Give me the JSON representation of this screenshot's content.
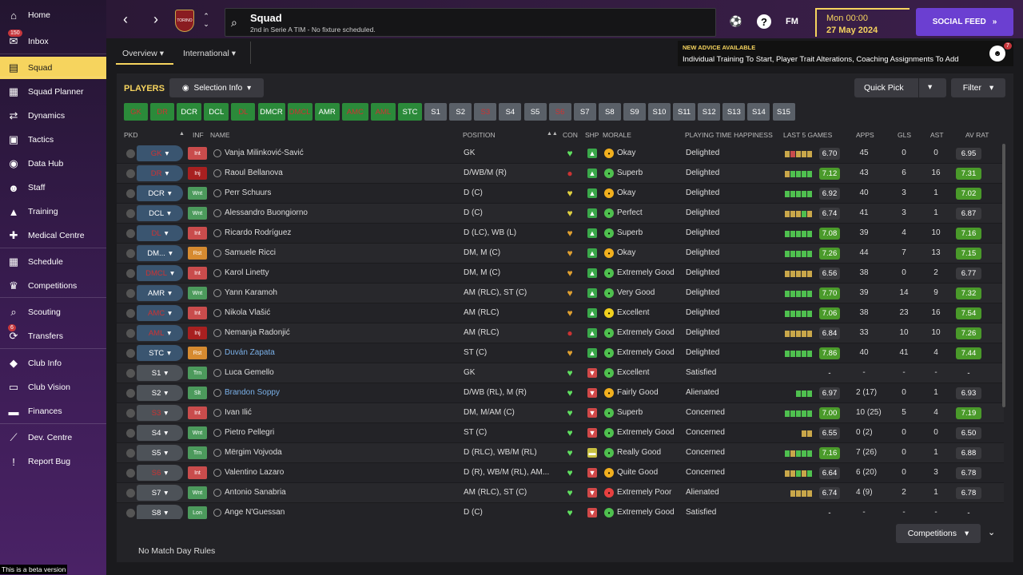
{
  "sidebar": {
    "items": [
      {
        "label": "Home",
        "icon": "home-icon",
        "glyph": "⌂",
        "badge": ""
      },
      {
        "label": "Inbox",
        "icon": "inbox-icon",
        "glyph": "✉",
        "badge": "150"
      },
      {
        "label": "Squad",
        "icon": "squad-icon",
        "glyph": "▤",
        "badge": "",
        "active": true
      },
      {
        "label": "Squad Planner",
        "icon": "squad-planner-icon",
        "glyph": "▦",
        "badge": ""
      },
      {
        "label": "Dynamics",
        "icon": "dynamics-icon",
        "glyph": "⇄",
        "badge": ""
      },
      {
        "label": "Tactics",
        "icon": "tactics-icon",
        "glyph": "▣",
        "badge": ""
      },
      {
        "label": "Data Hub",
        "icon": "data-hub-icon",
        "glyph": "◉",
        "badge": ""
      },
      {
        "label": "Staff",
        "icon": "staff-icon",
        "glyph": "☻",
        "badge": ""
      },
      {
        "label": "Training",
        "icon": "training-icon",
        "glyph": "▲",
        "badge": ""
      },
      {
        "label": "Medical Centre",
        "icon": "medical-icon",
        "glyph": "✚",
        "badge": ""
      },
      {
        "label": "Schedule",
        "icon": "schedule-icon",
        "glyph": "▦",
        "badge": ""
      },
      {
        "label": "Competitions",
        "icon": "trophy-icon",
        "glyph": "♛",
        "badge": ""
      },
      {
        "label": "Scouting",
        "icon": "scouting-icon",
        "glyph": "⌕",
        "badge": ""
      },
      {
        "label": "Transfers",
        "icon": "transfers-icon",
        "glyph": "⟳",
        "badge": "6"
      },
      {
        "label": "Club Info",
        "icon": "club-info-icon",
        "glyph": "◆",
        "badge": ""
      },
      {
        "label": "Club Vision",
        "icon": "club-vision-icon",
        "glyph": "▭",
        "badge": ""
      },
      {
        "label": "Finances",
        "icon": "finances-icon",
        "glyph": "▬",
        "badge": ""
      },
      {
        "label": "Dev. Centre",
        "icon": "dev-centre-icon",
        "glyph": "⟋",
        "badge": ""
      },
      {
        "label": "Report Bug",
        "icon": "report-bug-icon",
        "glyph": "!",
        "badge": ""
      }
    ],
    "beta_note": "This is a beta version"
  },
  "header": {
    "title": "Squad",
    "subtitle": "2nd in Serie A TIM - No fixture scheduled.",
    "crest_text": "TORINO",
    "fm_logo": "FM",
    "date_time": "Mon 00:00",
    "date_day": "27 May 2024",
    "social_feed": "SOCIAL FEED"
  },
  "subtabs": {
    "overview": "Overview",
    "international": "International"
  },
  "advice": {
    "title": "NEW ADVICE AVAILABLE",
    "body": "Individual Training To Start, Player Trait Alterations, Coaching Assignments To Add",
    "badge": "7"
  },
  "panel": {
    "players_label": "PLAYERS",
    "selection_info": "Selection Info",
    "quick_pick": "Quick Pick",
    "filter": "Filter",
    "no_rules": "No Match Day Rules",
    "competitions": "Competitions"
  },
  "position_chips": [
    {
      "label": "GK",
      "kind": "inj"
    },
    {
      "label": "DR",
      "kind": "inj"
    },
    {
      "label": "DCR",
      "kind": "pos"
    },
    {
      "label": "DCL",
      "kind": "pos"
    },
    {
      "label": "DL",
      "kind": "inj"
    },
    {
      "label": "DMCR",
      "kind": "pos"
    },
    {
      "label": "DMCL",
      "kind": "inj"
    },
    {
      "label": "AMR",
      "kind": "pos"
    },
    {
      "label": "AMC",
      "kind": "inj"
    },
    {
      "label": "AML",
      "kind": "inj"
    },
    {
      "label": "STC",
      "kind": "pos"
    },
    {
      "label": "S1",
      "kind": "sub"
    },
    {
      "label": "S2",
      "kind": "sub"
    },
    {
      "label": "S3",
      "kind": "subinj"
    },
    {
      "label": "S4",
      "kind": "sub"
    },
    {
      "label": "S5",
      "kind": "sub"
    },
    {
      "label": "S6",
      "kind": "subinj"
    },
    {
      "label": "S7",
      "kind": "sub"
    },
    {
      "label": "S8",
      "kind": "sub"
    },
    {
      "label": "S9",
      "kind": "sub"
    },
    {
      "label": "S10",
      "kind": "sub"
    },
    {
      "label": "S11",
      "kind": "sub"
    },
    {
      "label": "S12",
      "kind": "sub"
    },
    {
      "label": "S13",
      "kind": "sub"
    },
    {
      "label": "S14",
      "kind": "sub"
    },
    {
      "label": "S15",
      "kind": "sub"
    }
  ],
  "columns": {
    "pkd": "PKD",
    "inf": "INF",
    "name": "NAME",
    "position": "POSITION",
    "con": "CON",
    "shp": "SHP",
    "morale": "MORALE",
    "pth": "PLAYING TIME HAPPINESS",
    "last5": "LAST 5 GAMES",
    "apps": "APPS",
    "gls": "GLS",
    "ast": "AST",
    "avrat": "AV RAT"
  },
  "players": [
    {
      "pkd": "GK",
      "pkdinj": true,
      "sub": false,
      "inf": "Int",
      "infc": "#c94c4c",
      "name": "Vanja Milinković-Savić",
      "link": false,
      "position": "GK",
      "con": "green",
      "shp": "green",
      "morale": "Okay",
      "morc": "#f2b01e",
      "pth": "Delighted",
      "l5": [
        "#c9a74a",
        "#c94c4c",
        "#c9a74a",
        "#c9a74a",
        "#c9a74a"
      ],
      "l5rat": "6.70",
      "l5c": "",
      "apps": "45",
      "gls": "0",
      "ast": "0",
      "avrat": "6.95",
      "avc": ""
    },
    {
      "pkd": "DR",
      "pkdinj": true,
      "sub": false,
      "inf": "Inj",
      "infc": "#a82020",
      "name": "Raoul Bellanova",
      "link": false,
      "position": "D/WB/M (R)",
      "con": "red",
      "shp": "green",
      "morale": "Superb",
      "morc": "#4fc04f",
      "pth": "Delighted",
      "l5": [
        "#c9a74a",
        "#4fc04f",
        "#4fc04f",
        "#4fc04f",
        "#4fc04f"
      ],
      "l5rat": "7.12",
      "l5c": "#4a9a2a",
      "apps": "43",
      "gls": "6",
      "ast": "16",
      "avrat": "7.31",
      "avc": "#4a9a2a"
    },
    {
      "pkd": "DCR",
      "pkdinj": false,
      "sub": false,
      "inf": "Wnt",
      "infc": "#4c9a5c",
      "name": "Perr Schuurs",
      "link": false,
      "position": "D (C)",
      "con": "yellow",
      "shp": "green",
      "morale": "Okay",
      "morc": "#f2b01e",
      "pth": "Delighted",
      "l5": [
        "#4fc04f",
        "#4fc04f",
        "#4fc04f",
        "#4fc04f",
        "#4fc04f"
      ],
      "l5rat": "6.92",
      "l5c": "",
      "apps": "40",
      "gls": "3",
      "ast": "1",
      "avrat": "7.02",
      "avc": "#4a9a2a"
    },
    {
      "pkd": "DCL",
      "pkdinj": false,
      "sub": false,
      "inf": "Wnt",
      "infc": "#4c9a5c",
      "name": "Alessandro Buongiorno",
      "link": false,
      "position": "D (C)",
      "con": "yellow",
      "shp": "green",
      "morale": "Perfect",
      "morc": "#4fc04f",
      "pth": "Delighted",
      "l5": [
        "#c9a74a",
        "#c9a74a",
        "#c9a74a",
        "#4fc04f",
        "#c9a74a"
      ],
      "l5rat": "6.74",
      "l5c": "",
      "apps": "41",
      "gls": "3",
      "ast": "1",
      "avrat": "6.87",
      "avc": ""
    },
    {
      "pkd": "DL",
      "pkdinj": true,
      "sub": false,
      "inf": "Int",
      "infc": "#c94c4c",
      "name": "Ricardo Rodríguez",
      "link": false,
      "position": "D (LC), WB (L)",
      "con": "orange",
      "shp": "green",
      "morale": "Superb",
      "morc": "#4fc04f",
      "pth": "Delighted",
      "l5": [
        "#4fc04f",
        "#4fc04f",
        "#4fc04f",
        "#4fc04f",
        "#4fc04f"
      ],
      "l5rat": "7.08",
      "l5c": "#4a9a2a",
      "apps": "39",
      "gls": "4",
      "ast": "10",
      "avrat": "7.16",
      "avc": "#4a9a2a"
    },
    {
      "pkd": "DM...",
      "pkdinj": false,
      "sub": false,
      "inf": "Rst",
      "infc": "#d68a30",
      "name": "Samuele Ricci",
      "link": false,
      "position": "DM, M (C)",
      "con": "orange",
      "shp": "green",
      "morale": "Okay",
      "morc": "#f2b01e",
      "pth": "Delighted",
      "l5": [
        "#4fc04f",
        "#4fc04f",
        "#4fc04f",
        "#4fc04f",
        "#4fc04f"
      ],
      "l5rat": "7.26",
      "l5c": "#4a9a2a",
      "apps": "44",
      "gls": "7",
      "ast": "13",
      "avrat": "7.15",
      "avc": "#4a9a2a"
    },
    {
      "pkd": "DMCL",
      "pkdinj": true,
      "sub": false,
      "inf": "Int",
      "infc": "#c94c4c",
      "name": "Karol Linetty",
      "link": false,
      "position": "DM, M (C)",
      "con": "orange",
      "shp": "green",
      "morale": "Extremely Good",
      "morc": "#4fc04f",
      "pth": "Delighted",
      "l5": [
        "#c9a74a",
        "#c9a74a",
        "#c9a74a",
        "#c9a74a",
        "#c9a74a"
      ],
      "l5rat": "6.56",
      "l5c": "",
      "apps": "38",
      "gls": "0",
      "ast": "2",
      "avrat": "6.77",
      "avc": ""
    },
    {
      "pkd": "AMR",
      "pkdinj": false,
      "sub": false,
      "inf": "Wnt",
      "infc": "#4c9a5c",
      "name": "Yann Karamoh",
      "link": false,
      "position": "AM (RLC), ST (C)",
      "con": "orange",
      "shp": "green",
      "morale": "Very Good",
      "morc": "#4fc04f",
      "pth": "Delighted",
      "l5": [
        "#4fc04f",
        "#4fc04f",
        "#4fc04f",
        "#4fc04f",
        "#4fc04f"
      ],
      "l5rat": "7.70",
      "l5c": "#4a9a2a",
      "apps": "39",
      "gls": "14",
      "ast": "9",
      "avrat": "7.32",
      "avc": "#4a9a2a"
    },
    {
      "pkd": "AMC",
      "pkdinj": true,
      "sub": false,
      "inf": "Int",
      "infc": "#c94c4c",
      "name": "Nikola Vlašić",
      "link": false,
      "position": "AM (RLC)",
      "con": "orange",
      "shp": "green",
      "morale": "Excellent",
      "morc": "#f2d01e",
      "pth": "Delighted",
      "l5": [
        "#4fc04f",
        "#4fc04f",
        "#4fc04f",
        "#4fc04f",
        "#4fc04f"
      ],
      "l5rat": "7.06",
      "l5c": "#4a9a2a",
      "apps": "38",
      "gls": "23",
      "ast": "16",
      "avrat": "7.54",
      "avc": "#4a9a2a"
    },
    {
      "pkd": "AML",
      "pkdinj": true,
      "sub": false,
      "inf": "Inj",
      "infc": "#a82020",
      "name": "Nemanja Radonjić",
      "link": false,
      "position": "AM (RLC)",
      "con": "red",
      "shp": "green",
      "morale": "Extremely Good",
      "morc": "#4fc04f",
      "pth": "Delighted",
      "l5": [
        "#c9a74a",
        "#c9a74a",
        "#c9a74a",
        "#c9a74a",
        "#c9a74a"
      ],
      "l5rat": "6.84",
      "l5c": "",
      "apps": "33",
      "gls": "10",
      "ast": "10",
      "avrat": "7.26",
      "avc": "#4a9a2a"
    },
    {
      "pkd": "STC",
      "pkdinj": false,
      "sub": false,
      "inf": "Rst",
      "infc": "#d68a30",
      "name": "Duván Zapata",
      "link": true,
      "position": "ST (C)",
      "con": "orange",
      "shp": "green",
      "morale": "Extremely Good",
      "morc": "#4fc04f",
      "pth": "Delighted",
      "l5": [
        "#4fc04f",
        "#4fc04f",
        "#4fc04f",
        "#4fc04f",
        "#4fc04f"
      ],
      "l5rat": "7.86",
      "l5c": "#4a9a2a",
      "apps": "40",
      "gls": "41",
      "ast": "4",
      "avrat": "7.44",
      "avc": "#4a9a2a"
    },
    {
      "pkd": "S1",
      "pkdinj": false,
      "sub": true,
      "inf": "Trn",
      "infc": "#4c9a5c",
      "name": "Luca Gemello",
      "link": false,
      "position": "GK",
      "con": "green",
      "shp": "red",
      "morale": "Excellent",
      "morc": "#4fc04f",
      "pth": "Satisfied",
      "l5": [],
      "l5rat": "-",
      "l5c": "none",
      "apps": "-",
      "gls": "-",
      "ast": "-",
      "avrat": "-",
      "avc": "none"
    },
    {
      "pkd": "S2",
      "pkdinj": false,
      "sub": true,
      "inf": "Slt",
      "infc": "#4c9a5c",
      "name": "Brandon Soppy",
      "link": true,
      "position": "D/WB (RL), M (R)",
      "con": "green",
      "shp": "red",
      "morale": "Fairly Good",
      "morc": "#f2b01e",
      "pth": "Alienated",
      "l5": [
        "#4fc04f",
        "#4fc04f",
        "#4fc04f"
      ],
      "l5rat": "6.97",
      "l5c": "",
      "apps": "2 (17)",
      "gls": "0",
      "ast": "1",
      "avrat": "6.93",
      "avc": ""
    },
    {
      "pkd": "S3",
      "pkdinj": true,
      "sub": true,
      "inf": "Int",
      "infc": "#c94c4c",
      "name": "Ivan Ilić",
      "link": false,
      "position": "DM, M/AM (C)",
      "con": "green",
      "shp": "red",
      "morale": "Superb",
      "morc": "#4fc04f",
      "pth": "Concerned",
      "l5": [
        "#4fc04f",
        "#4fc04f",
        "#4fc04f",
        "#4fc04f",
        "#4fc04f"
      ],
      "l5rat": "7.00",
      "l5c": "#4a9a2a",
      "apps": "10 (25)",
      "gls": "5",
      "ast": "4",
      "avrat": "7.19",
      "avc": "#4a9a2a"
    },
    {
      "pkd": "S4",
      "pkdinj": false,
      "sub": true,
      "inf": "Wnt",
      "infc": "#4c9a5c",
      "name": "Pietro Pellegri",
      "link": false,
      "position": "ST (C)",
      "con": "green",
      "shp": "red",
      "morale": "Extremely Good",
      "morc": "#4fc04f",
      "pth": "Concerned",
      "l5": [
        "#c9a74a",
        "#c9a74a"
      ],
      "l5rat": "6.55",
      "l5c": "",
      "apps": "0 (2)",
      "gls": "0",
      "ast": "0",
      "avrat": "6.50",
      "avc": ""
    },
    {
      "pkd": "S5",
      "pkdinj": false,
      "sub": true,
      "inf": "Trn",
      "infc": "#4c9a5c",
      "name": "Mërgim Vojvoda",
      "link": false,
      "position": "D (RLC), WB/M (RL)",
      "con": "green",
      "shp": "yellow",
      "morale": "Really Good",
      "morc": "#4fc04f",
      "pth": "Concerned",
      "l5": [
        "#4fc04f",
        "#c9a74a",
        "#4fc04f",
        "#4fc04f",
        "#4fc04f"
      ],
      "l5rat": "7.16",
      "l5c": "#4a9a2a",
      "apps": "7 (26)",
      "gls": "0",
      "ast": "1",
      "avrat": "6.88",
      "avc": ""
    },
    {
      "pkd": "S6",
      "pkdinj": true,
      "sub": true,
      "inf": "Int",
      "infc": "#c94c4c",
      "name": "Valentino Lazaro",
      "link": false,
      "position": "D (R), WB/M (RL), AM...",
      "con": "green",
      "shp": "red",
      "morale": "Quite Good",
      "morc": "#f2b01e",
      "pth": "Concerned",
      "l5": [
        "#c9a74a",
        "#c9a74a",
        "#4fc04f",
        "#c9a74a",
        "#4fc04f"
      ],
      "l5rat": "6.64",
      "l5c": "",
      "apps": "6 (20)",
      "gls": "0",
      "ast": "3",
      "avrat": "6.78",
      "avc": ""
    },
    {
      "pkd": "S7",
      "pkdinj": false,
      "sub": true,
      "inf": "Wnt",
      "infc": "#4c9a5c",
      "name": "Antonio Sanabria",
      "link": false,
      "position": "AM (RLC), ST (C)",
      "con": "green",
      "shp": "red",
      "morale": "Extremely Poor",
      "morc": "#e84040",
      "pth": "Alienated",
      "l5": [
        "#c9a74a",
        "#c9a74a",
        "#c9a74a",
        "#c9a74a"
      ],
      "l5rat": "6.74",
      "l5c": "",
      "apps": "4 (9)",
      "gls": "2",
      "ast": "1",
      "avrat": "6.78",
      "avc": ""
    },
    {
      "pkd": "S8",
      "pkdinj": false,
      "sub": true,
      "inf": "Lon",
      "infc": "#4c9a5c",
      "name": "Ange N'Guessan",
      "link": false,
      "position": "D (C)",
      "con": "green",
      "shp": "red",
      "morale": "Extremely Good",
      "morc": "#4fc04f",
      "pth": "Satisfied",
      "l5": [],
      "l5rat": "-",
      "l5c": "none",
      "apps": "-",
      "gls": "-",
      "ast": "-",
      "avrat": "-",
      "avc": "none"
    }
  ]
}
